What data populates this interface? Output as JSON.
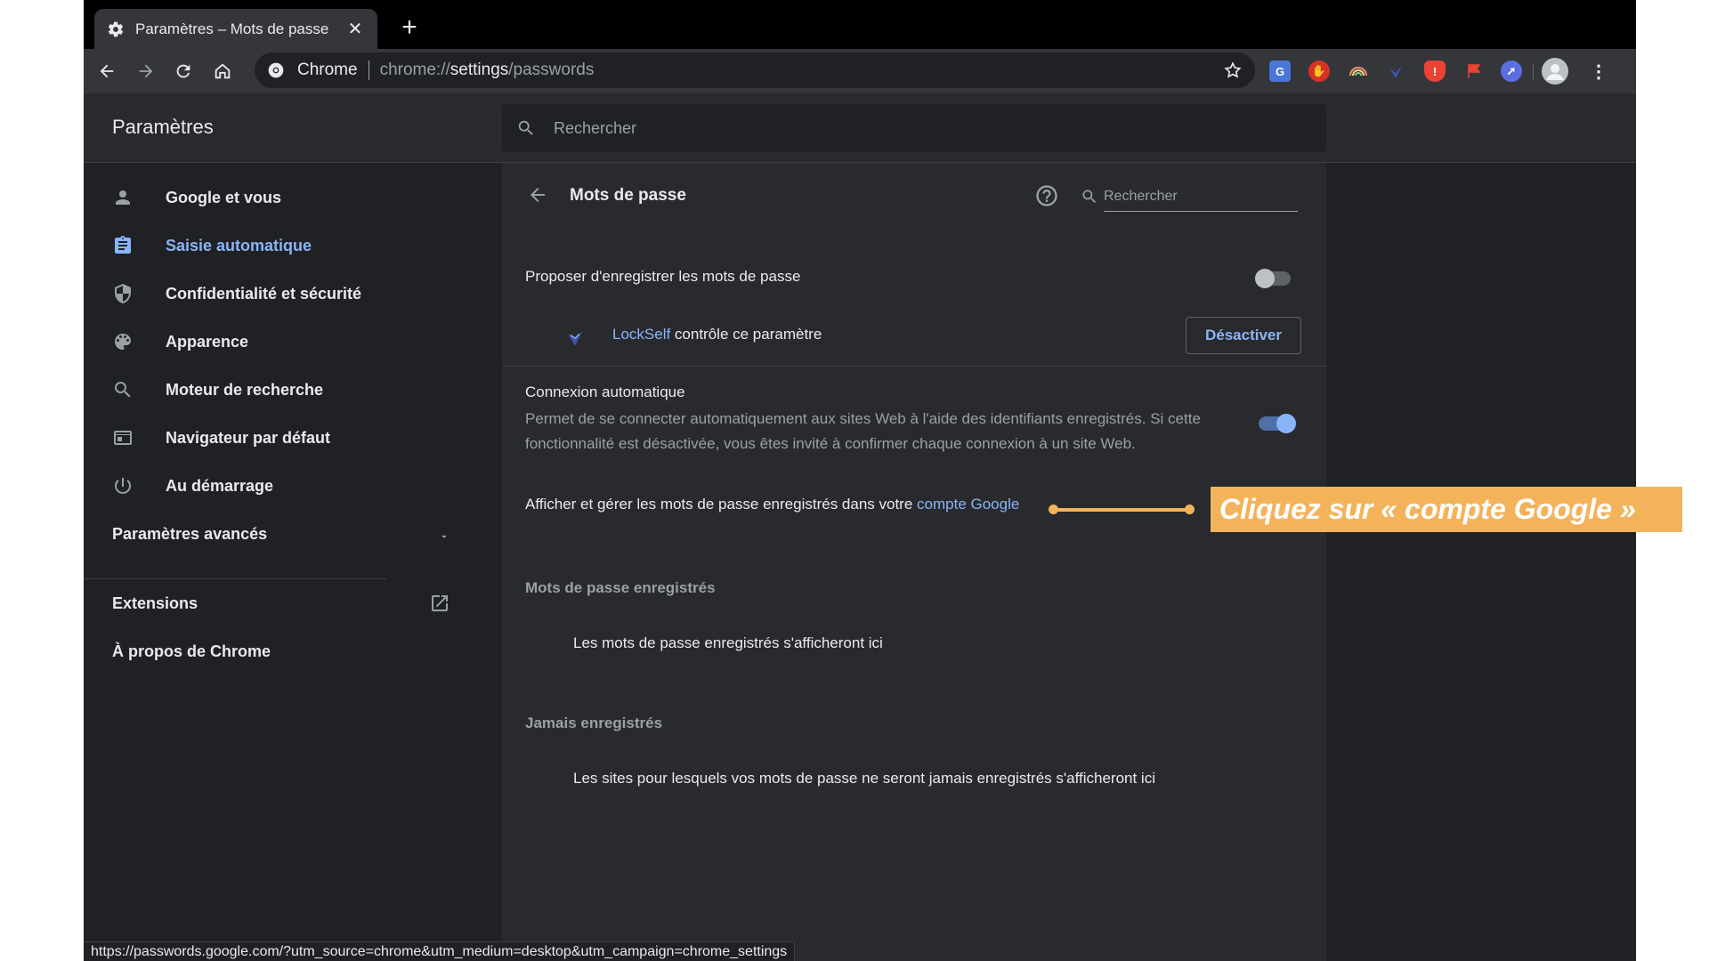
{
  "browser": {
    "tab_title": "Paramètres – Mots de passe",
    "omnibox": {
      "origin": "Chrome",
      "url_scheme": "chrome://",
      "url_host": "settings",
      "url_path": "/passwords"
    },
    "status_url": "https://passwords.google.com/?utm_source=chrome&utm_medium=desktop&utm_campaign=chrome_settings"
  },
  "settings": {
    "title": "Paramètres",
    "search_placeholder": "Rechercher"
  },
  "sidebar": {
    "items": [
      {
        "label": "Google et vous",
        "icon": "person-icon"
      },
      {
        "label": "Saisie automatique",
        "icon": "clipboard-icon",
        "active": true
      },
      {
        "label": "Confidentialité et sécurité",
        "icon": "shield-icon"
      },
      {
        "label": "Apparence",
        "icon": "palette-icon"
      },
      {
        "label": "Moteur de recherche",
        "icon": "search-icon"
      },
      {
        "label": "Navigateur par défaut",
        "icon": "browser-icon"
      },
      {
        "label": "Au démarrage",
        "icon": "power-icon"
      }
    ],
    "advanced": "Paramètres avancés",
    "extensions": "Extensions",
    "about": "À propos de Chrome"
  },
  "passwords": {
    "title": "Mots de passe",
    "search_placeholder": "Rechercher",
    "offer_save": {
      "label": "Proposer d'enregistrer les mots de passe",
      "enabled": false
    },
    "lockself": {
      "name": "LockSelf",
      "text": " contrôle ce paramètre",
      "button": "Désactiver"
    },
    "auto_signin": {
      "title": "Connexion automatique",
      "description": "Permet de se connecter automatiquement aux sites Web à l'aide des identifiants enregistrés. Si cette fonctionnalité est désactivée, vous êtes invité à confirmer chaque connexion à un site Web.",
      "enabled": true
    },
    "manage": {
      "text": "Afficher et gérer les mots de passe enregistrés dans votre ",
      "link": "compte Google"
    },
    "saved": {
      "title": "Mots de passe enregistrés",
      "empty": "Les mots de passe enregistrés s'afficheront ici"
    },
    "never": {
      "title": "Jamais enregistrés",
      "empty": "Les sites pour lesquels vos mots de passe ne seront jamais enregistrés s'afficheront ici"
    }
  },
  "annotation": {
    "text": "Cliquez sur « compte Google »",
    "color": "#f4b35a"
  },
  "colors": {
    "accent": "#8ab4f8",
    "background": "#202124",
    "surface": "#292a2d"
  }
}
